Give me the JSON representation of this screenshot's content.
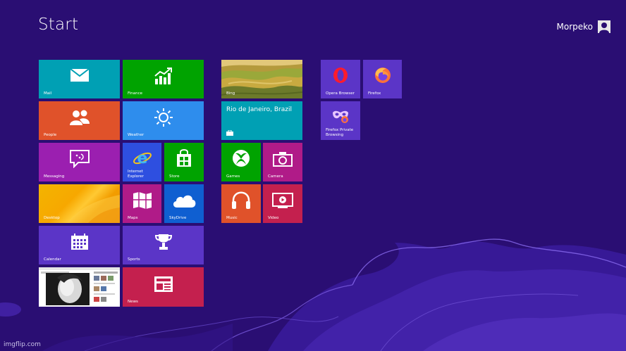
{
  "header": {
    "title": "Start"
  },
  "user": {
    "name": "Morpeko"
  },
  "tiles": {
    "mail": "Mail",
    "finance": "Finance",
    "bing": "Bing",
    "opera": "Opera Browser",
    "firefox": "Firefox",
    "people": "People",
    "weather": "Weather",
    "weather_location": "Rio de Janeiro, Brazil",
    "firefox_private": "Firefox Private Browsing",
    "messaging": "Messaging",
    "ie": "Internet Explorer",
    "store": "Store",
    "games": "Games",
    "camera": "Camera",
    "desktop": "Desktop",
    "maps": "Maps",
    "skydrive": "SkyDrive",
    "music": "Music",
    "video": "Video",
    "calendar": "Calendar",
    "sports": "Sports",
    "news": "News"
  },
  "colors": {
    "background": "#2a0e73",
    "teal": "#00a0b4",
    "green": "#00a300",
    "orange": "#e0522a",
    "blue": "#2e8ded",
    "purple": "#9b1fb0",
    "indigo": "#5b35c7",
    "red": "#c4204e",
    "magenta": "#b01b88"
  },
  "watermark": "imgflip.com"
}
